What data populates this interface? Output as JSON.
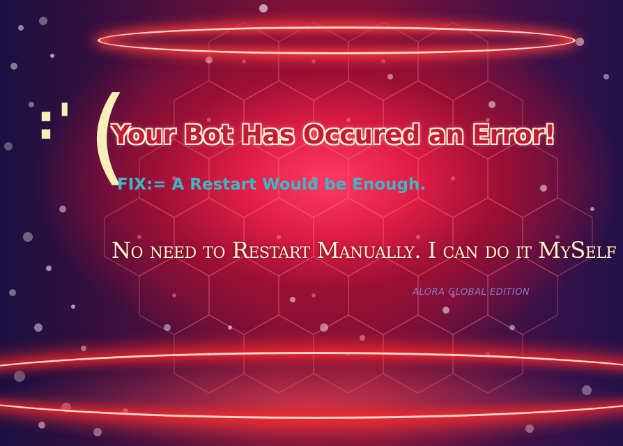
{
  "emoticon": {
    "eyes": ":",
    "tear": "'",
    "mouth": "("
  },
  "title": "Your Bot Has Occured an Error!",
  "fix_text": "FIX:= A Restart Would be Enough.",
  "restart_note": "No need to Restart Manually. I can do it MySelf",
  "edition_label": "ALORA GLOBAL EDITION",
  "colors": {
    "background_deep": "#1a0a2e",
    "background_glow": "#e01d45",
    "ring_glow": "#ff3b3b",
    "title_text": "#c11a3a",
    "title_outline": "#fff4d0",
    "fix_text": "#3fb6c6",
    "note_text": "#fff6cf",
    "edition_text": "#8a78c8"
  }
}
